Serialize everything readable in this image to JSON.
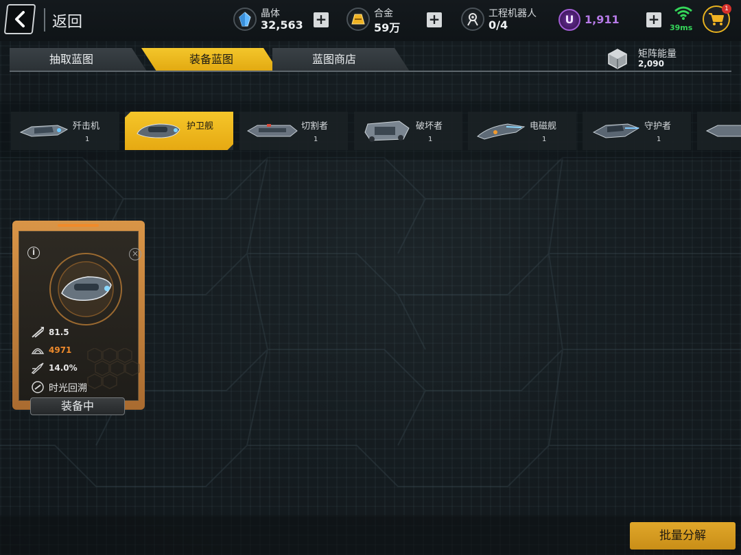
{
  "topbar": {
    "back_label": "返回",
    "resources": [
      {
        "name": "晶体",
        "value": "32,563",
        "icon": "crystal-icon"
      },
      {
        "name": "合金",
        "value": "59万",
        "icon": "alloy-icon"
      },
      {
        "name": "工程机器人",
        "value": "0/4",
        "icon": "robot-icon"
      }
    ],
    "u_label": "U",
    "u_value": "1,911",
    "ping": "39ms",
    "cart_badge": "1"
  },
  "tabs": [
    {
      "label": "抽取蓝图",
      "active": false
    },
    {
      "label": "装备蓝图",
      "active": true
    },
    {
      "label": "蓝图商店",
      "active": false
    }
  ],
  "matrix": {
    "name": "矩阵能量",
    "value": "2,090"
  },
  "ships": [
    {
      "name": "歼击机",
      "count": "1",
      "active": false
    },
    {
      "name": "护卫舰",
      "count": "",
      "active": true
    },
    {
      "name": "切割者",
      "count": "1",
      "active": false
    },
    {
      "name": "破坏者",
      "count": "1",
      "active": false
    },
    {
      "name": "电磁舰",
      "count": "1",
      "active": false
    },
    {
      "name": "守护者",
      "count": "1",
      "active": false
    }
  ],
  "card": {
    "info_label": "i",
    "close_label": "×",
    "stats": [
      {
        "icon": "attack-icon",
        "value": "81.5"
      },
      {
        "icon": "armor-icon",
        "value": "4971"
      },
      {
        "icon": "speed-icon",
        "value": "14.0%"
      }
    ],
    "skill": "时光回溯",
    "status": "装备中"
  },
  "actions": {
    "batch_decompose": "批量分解"
  },
  "colors": {
    "accent": "#e6a912",
    "card_frame": "#d99547",
    "u_purple": "#b77be8",
    "ping_green": "#35d65a"
  }
}
